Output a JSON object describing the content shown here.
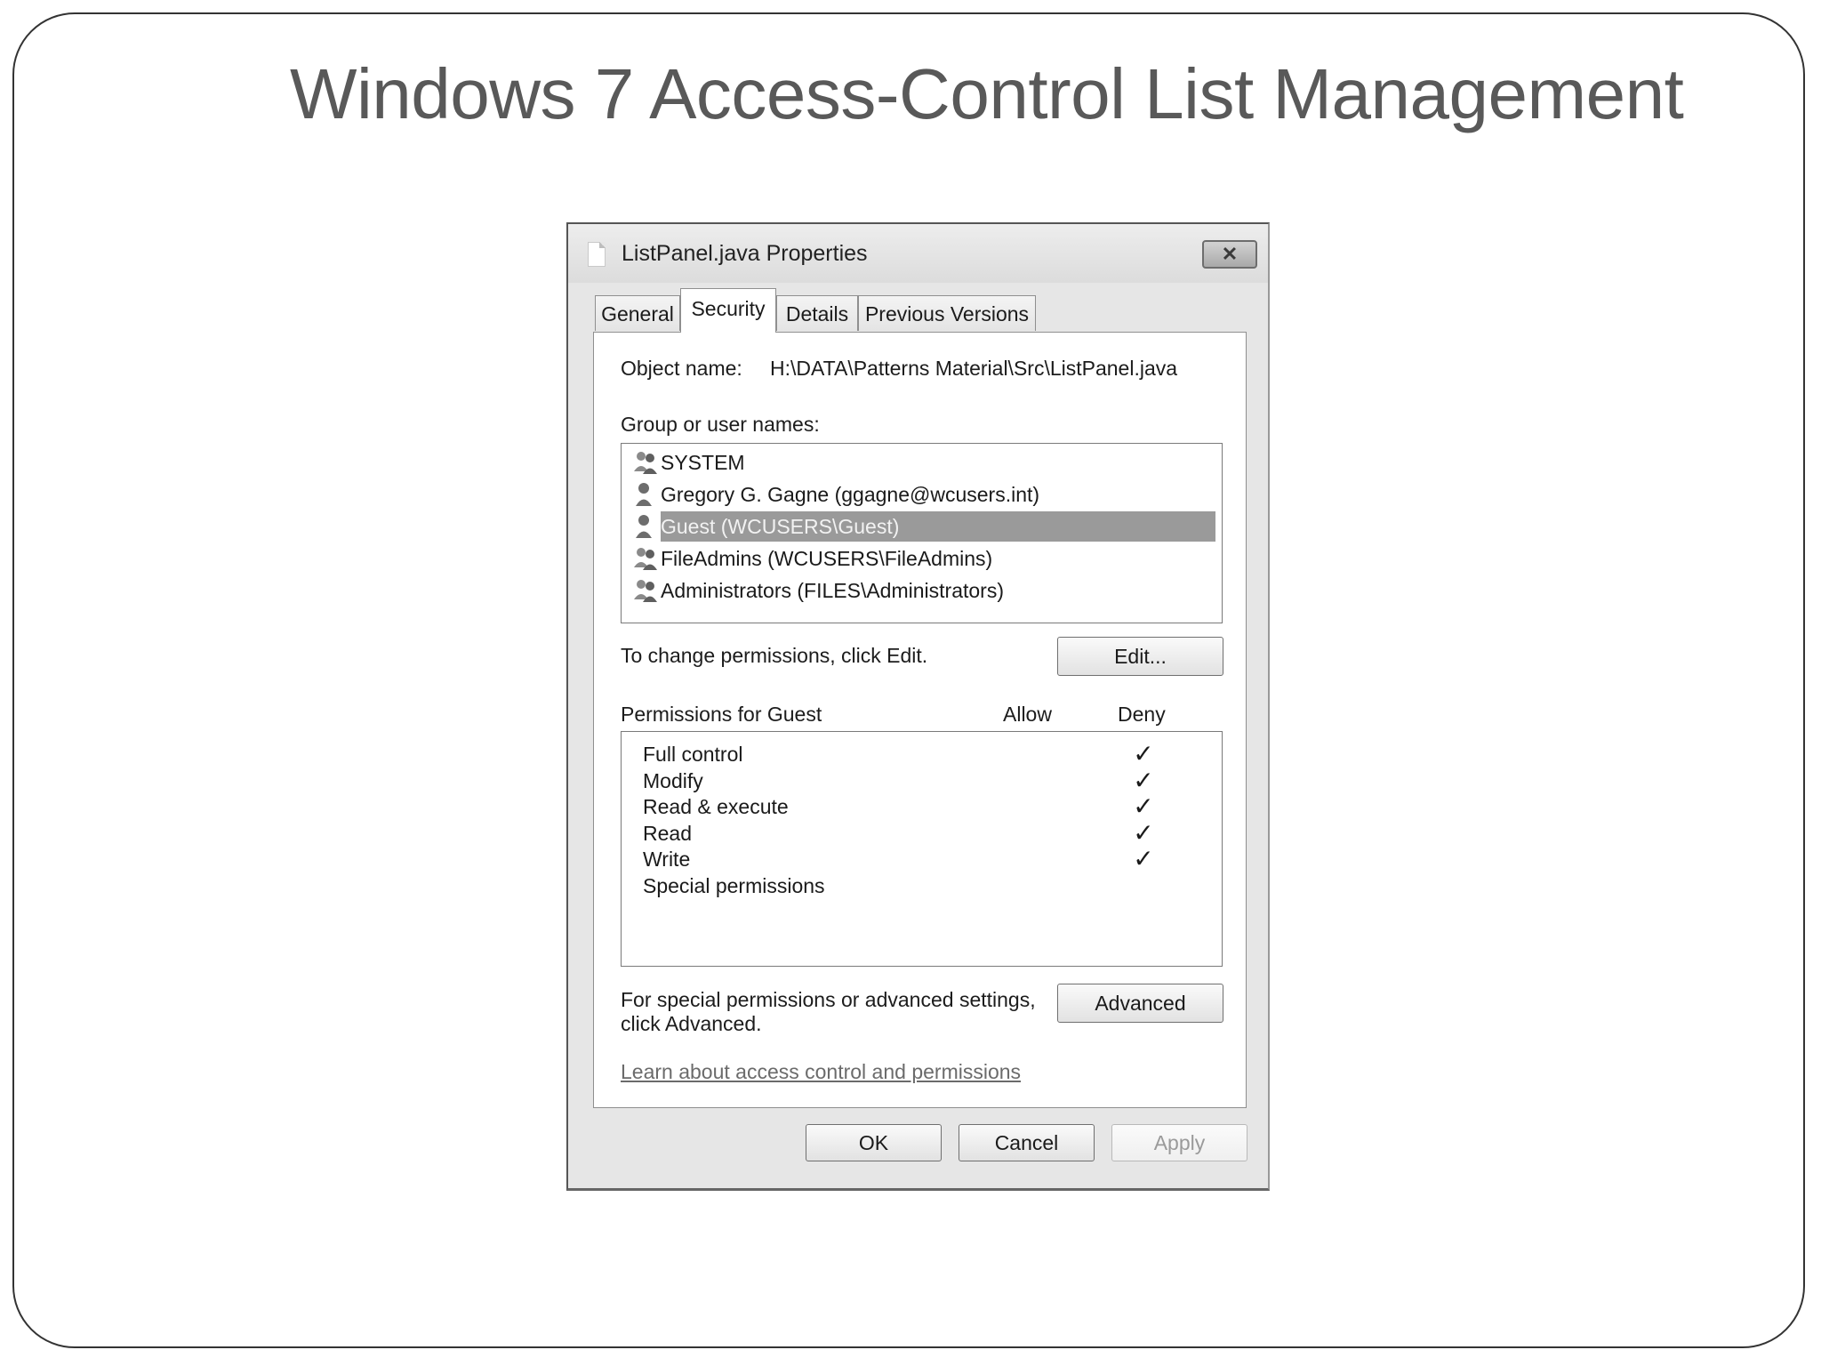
{
  "slide": {
    "title": "Windows 7 Access-Control List Management"
  },
  "window": {
    "title": "ListPanel.java Properties",
    "close_glyph": "✕",
    "file_icon": "document-icon"
  },
  "tabs": [
    {
      "label": "General",
      "active": false
    },
    {
      "label": "Security",
      "active": true
    },
    {
      "label": "Details",
      "active": false
    },
    {
      "label": "Previous Versions",
      "active": false
    }
  ],
  "security": {
    "object_name_label": "Object name:",
    "object_name_value": "H:\\DATA\\Patterns Material\\Src\\ListPanel.java",
    "group_label": "Group or user names:",
    "users": [
      {
        "name": "SYSTEM",
        "icon": "user-group-icon",
        "selected": false
      },
      {
        "name": "Gregory G. Gagne (ggagne@wcusers.int)",
        "icon": "user-icon",
        "selected": false
      },
      {
        "name": "Guest (WCUSERS\\Guest)",
        "icon": "user-icon",
        "selected": true
      },
      {
        "name": "FileAdmins (WCUSERS\\FileAdmins)",
        "icon": "user-group-icon",
        "selected": false
      },
      {
        "name": "Administrators (FILES\\Administrators)",
        "icon": "user-group-icon",
        "selected": false
      }
    ],
    "change_text": "To change permissions, click Edit.",
    "edit_label": "Edit...",
    "permissions_label": "Permissions for Guest",
    "allow_header": "Allow",
    "deny_header": "Deny",
    "permissions": [
      {
        "name": "Full control",
        "allow": false,
        "deny": true
      },
      {
        "name": "Modify",
        "allow": false,
        "deny": true
      },
      {
        "name": "Read & execute",
        "allow": false,
        "deny": true
      },
      {
        "name": "Read",
        "allow": false,
        "deny": true
      },
      {
        "name": "Write",
        "allow": false,
        "deny": true
      },
      {
        "name": "Special permissions",
        "allow": false,
        "deny": false
      }
    ],
    "check_glyph": "✓",
    "advanced_text_line1": "For special permissions or advanced settings,",
    "advanced_text_line2": "click Advanced.",
    "advanced_label": "Advanced",
    "learn_link": "Learn about access control and permissions"
  },
  "footer": {
    "ok_label": "OK",
    "cancel_label": "Cancel",
    "apply_label": "Apply",
    "apply_enabled": false
  }
}
